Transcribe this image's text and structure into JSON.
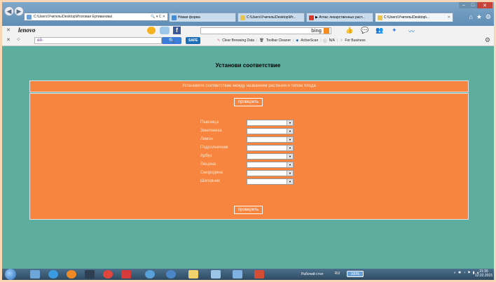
{
  "browser": {
    "address": "C:\\Users\\Учитель\\Desktop\\Итоговая Ертиванова\\",
    "address_controls": "🔍 ▾ C ✕",
    "tabs": [
      {
        "label": "Новая форма",
        "color": "#3e8fd8"
      },
      {
        "label": "C:\\Users\\Учитель\\Desktop\\Ит...",
        "color": "#e8c44a"
      },
      {
        "label": "▶ Атлас лекарственных раст...",
        "color": "#d8392b"
      },
      {
        "label": "C:\\Users\\Учитель\\Desktop\\...",
        "color": "#e8c44a",
        "active": true
      }
    ]
  },
  "toolbar1": {
    "brand": "lenovo",
    "bing": "bing"
  },
  "toolbar2": {
    "search_brand": "ей-",
    "safe_badge": "SAFE",
    "links": [
      "Clear Browsing Data",
      "Toolbar Cleaner",
      "ActiveScan",
      "N/A",
      "For Business"
    ]
  },
  "page": {
    "title": "Установи соответствие",
    "instruction": "Установите соответствие между названием растения и типом плода",
    "check_button": "проверить",
    "plants": [
      "Пшеница",
      "Земляника",
      "Лимон",
      "Подсолнечник",
      "Арбуз",
      "Лещина",
      "Смородина",
      "Шиповник"
    ]
  },
  "taskbar": {
    "desktop_label": "Рабочий стол",
    "lang": "RU",
    "zoom": "100%",
    "time": "21:35",
    "date": "12.02.2015"
  }
}
